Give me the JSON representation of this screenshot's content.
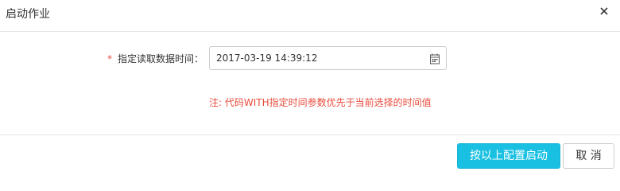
{
  "dialog": {
    "title": "启动作业",
    "close_icon": "close-icon"
  },
  "form": {
    "required_mark": "*",
    "label": "指定读取数据时间：",
    "datetime_value": "2017-03-19 14:39:12",
    "calendar_icon": "calendar-icon"
  },
  "note": "注: 代码WITH指定时间参数优先于当前选择的时间值",
  "footer": {
    "confirm_label": "按以上配置启动",
    "cancel_label": "取 消"
  },
  "colors": {
    "accent": "#19c0e2",
    "required": "#e84c3d",
    "note": "#e84c3d"
  }
}
